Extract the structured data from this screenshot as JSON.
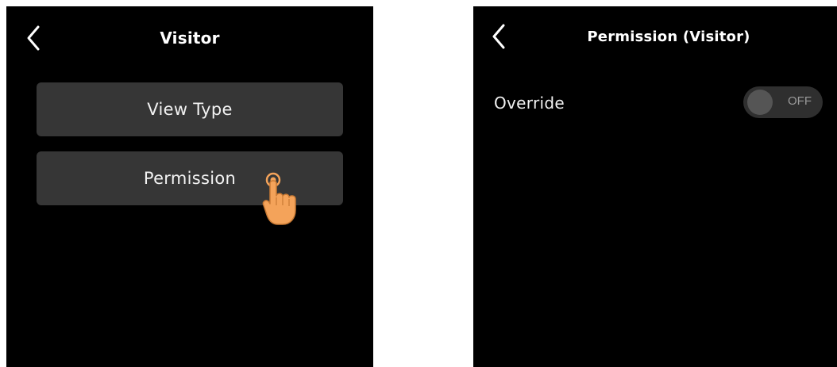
{
  "colors": {
    "screen_bg": "#000000",
    "button_bg": "#363636",
    "text": "#ffffff",
    "toggle_bg": "#2f2f2f",
    "toggle_knob": "#555555",
    "hand": "#f4a35a"
  },
  "left_screen": {
    "back_icon": "chevron-left-icon",
    "title": "Visitor",
    "menu": [
      {
        "label": "View Type"
      },
      {
        "label": "Permission"
      }
    ],
    "pointer_icon": "tap-hand-icon"
  },
  "right_screen": {
    "back_icon": "chevron-left-icon",
    "title": "Permission (Visitor)",
    "settings": [
      {
        "label": "Override",
        "toggle_state": "OFF",
        "enabled": false
      }
    ]
  }
}
